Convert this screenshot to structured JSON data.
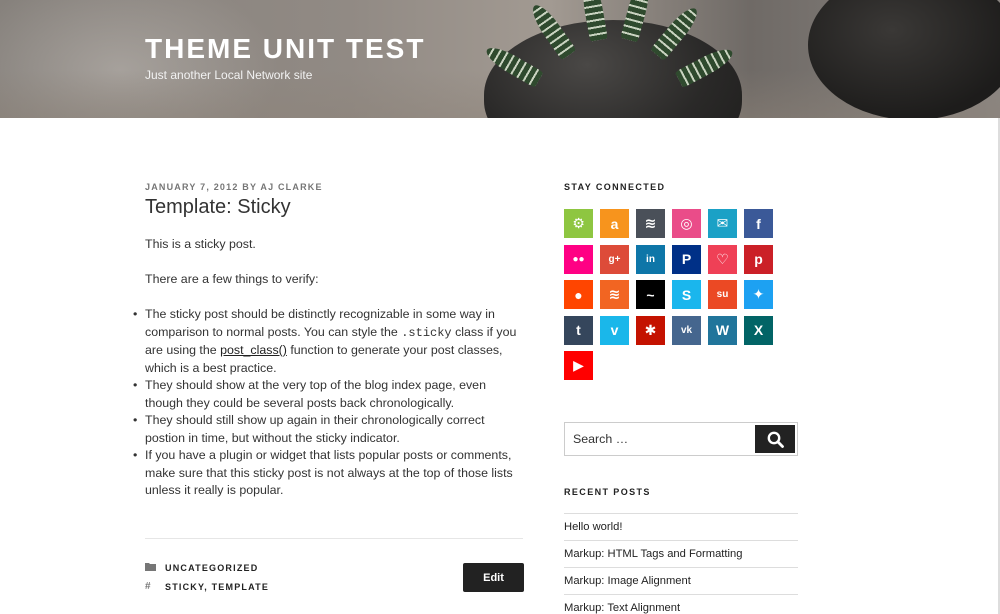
{
  "site": {
    "title": "THEME UNIT TEST",
    "tagline": "Just another Local Network site"
  },
  "post": {
    "date": "JANUARY 7, 2012",
    "by": "BY",
    "author": "AJ CLARKE",
    "title": "Template: Sticky",
    "p1": "This is a sticky post.",
    "p2": "There are a few things to verify:",
    "bullets": [
      {
        "a": "The sticky post should be distinctly recognizable in some way in comparison to normal posts. You can style the ",
        "code": ".sticky",
        "b": " class if you are using the ",
        "link": "post_class()",
        "c": " function to generate your post classes, which is a best practice."
      },
      "They should show at the very top of the blog index page, even though they could be several posts back chronologically.",
      "They should still show up again in their chronologically correct postion in time, but without the sticky indicator.",
      "If you have a plugin or widget that lists popular posts or comments, make sure that this sticky post is not always at the top of those lists unless it really is popular."
    ],
    "category": "UNCATEGORIZED",
    "tags": "STICKY, TEMPLATE",
    "edit_label": "Edit"
  },
  "sidebar": {
    "stay_connected": "STAY CONNECTED",
    "social": [
      {
        "icon": "android-icon",
        "glyph": "⚙",
        "color": "#8ec641"
      },
      {
        "icon": "amazon-icon",
        "glyph": "a",
        "color": "#f7941d"
      },
      {
        "icon": "buffer-icon",
        "glyph": "≋",
        "color": "#4a5059"
      },
      {
        "icon": "dribbble-icon",
        "glyph": "◎",
        "color": "#ea4c89"
      },
      {
        "icon": "email-icon",
        "glyph": "✉",
        "color": "#1ba1c6"
      },
      {
        "icon": "facebook-icon",
        "glyph": "f",
        "color": "#3b5998"
      },
      {
        "icon": "flickr-icon",
        "glyph": "●●",
        "color": "#ff0084"
      },
      {
        "icon": "googleplus-icon",
        "glyph": "g+",
        "color": "#dd4b39"
      },
      {
        "icon": "linkedin-icon",
        "glyph": "in",
        "color": "#0e76a8"
      },
      {
        "icon": "paypal-icon",
        "glyph": "P",
        "color": "#003087"
      },
      {
        "icon": "pocket-icon",
        "glyph": "♡",
        "color": "#ef4056"
      },
      {
        "icon": "pinterest-icon",
        "glyph": "p",
        "color": "#cb2027"
      },
      {
        "icon": "reddit-icon",
        "glyph": "●",
        "color": "#ff4500"
      },
      {
        "icon": "rss-icon",
        "glyph": "≋",
        "color": "#f26522"
      },
      {
        "icon": "steam-icon",
        "glyph": "~",
        "color": "#000000"
      },
      {
        "icon": "skype-icon",
        "glyph": "S",
        "color": "#1ab6ed"
      },
      {
        "icon": "stumbleupon-icon",
        "glyph": "su",
        "color": "#eb4924"
      },
      {
        "icon": "twitter-icon",
        "glyph": "✦",
        "color": "#1da1f2"
      },
      {
        "icon": "tumblr-icon",
        "glyph": "t",
        "color": "#35465c"
      },
      {
        "icon": "vimeo-icon",
        "glyph": "v",
        "color": "#1ab7ea"
      },
      {
        "icon": "yelp-icon",
        "glyph": "✱",
        "color": "#c41200"
      },
      {
        "icon": "vk-icon",
        "glyph": "vk",
        "color": "#45668e"
      },
      {
        "icon": "wordpress-icon",
        "glyph": "W",
        "color": "#21759b"
      },
      {
        "icon": "xing-icon",
        "glyph": "X",
        "color": "#026466"
      },
      {
        "icon": "youtube-icon",
        "glyph": "▶",
        "color": "#ff0000"
      }
    ],
    "search_placeholder": "Search …",
    "recent_posts_title": "RECENT POSTS",
    "recent_posts": [
      "Hello world!",
      "Markup: HTML Tags and Formatting",
      "Markup: Image Alignment",
      "Markup: Text Alignment"
    ]
  }
}
